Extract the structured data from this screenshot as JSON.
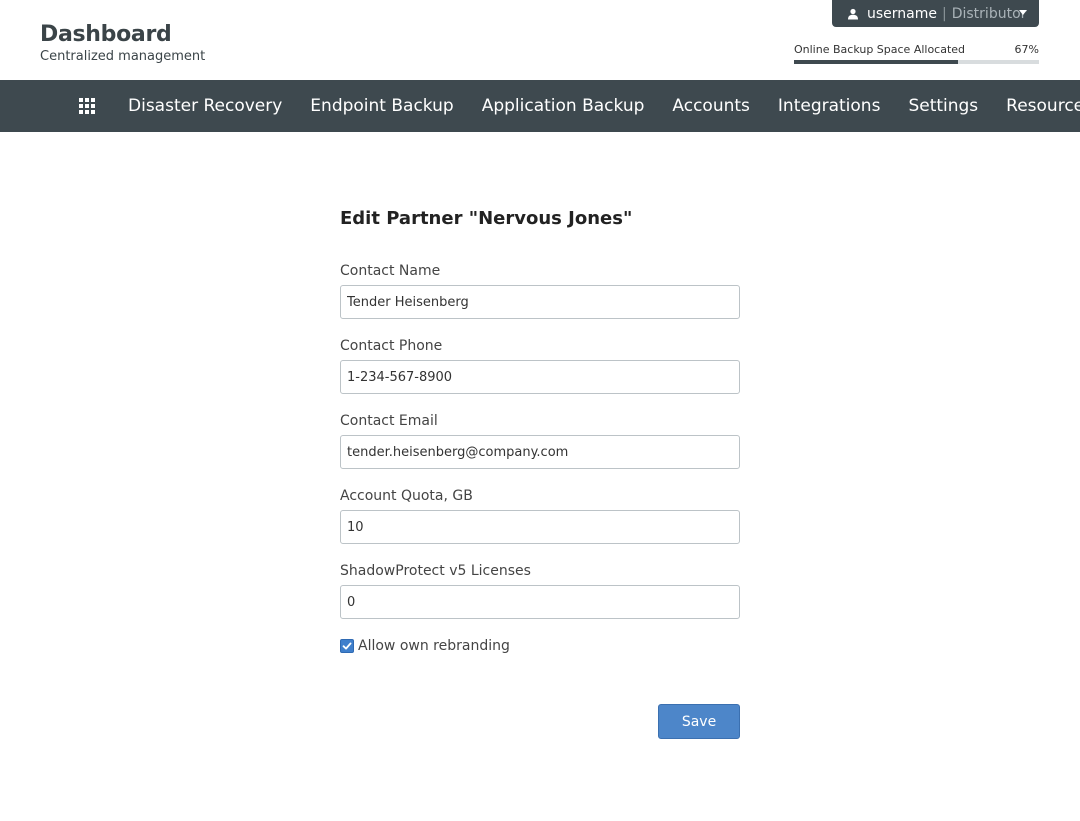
{
  "brand": {
    "title": "Dashboard",
    "subtitle": "Centralized management"
  },
  "user_menu": {
    "username": "username",
    "separator": "|",
    "role": "Distributor"
  },
  "quota": {
    "label": "Online Backup Space Allocated",
    "percent_text": "67%",
    "percent": 67
  },
  "nav": {
    "items": [
      {
        "label": "Disaster Recovery"
      },
      {
        "label": "Endpoint Backup"
      },
      {
        "label": "Application Backup"
      },
      {
        "label": "Accounts"
      },
      {
        "label": "Integrations"
      },
      {
        "label": "Settings"
      },
      {
        "label": "Resources"
      }
    ]
  },
  "form": {
    "title": "Edit Partner \"Nervous Jones\"",
    "fields": [
      {
        "label": "Contact Name",
        "value": "Tender Heisenberg"
      },
      {
        "label": "Contact Phone",
        "value": "1-234-567-8900"
      },
      {
        "label": "Contact Email",
        "value": "tender.heisenberg@company.com"
      },
      {
        "label": "Account Quota, GB",
        "value": "10"
      },
      {
        "label": "ShadowProtect v5 Licenses",
        "value": "0"
      }
    ],
    "checkbox": {
      "label": "Allow own rebranding",
      "checked": true
    },
    "save_label": "Save"
  },
  "colors": {
    "nav_bg": "#3e494f",
    "accent": "#4d86c9"
  }
}
